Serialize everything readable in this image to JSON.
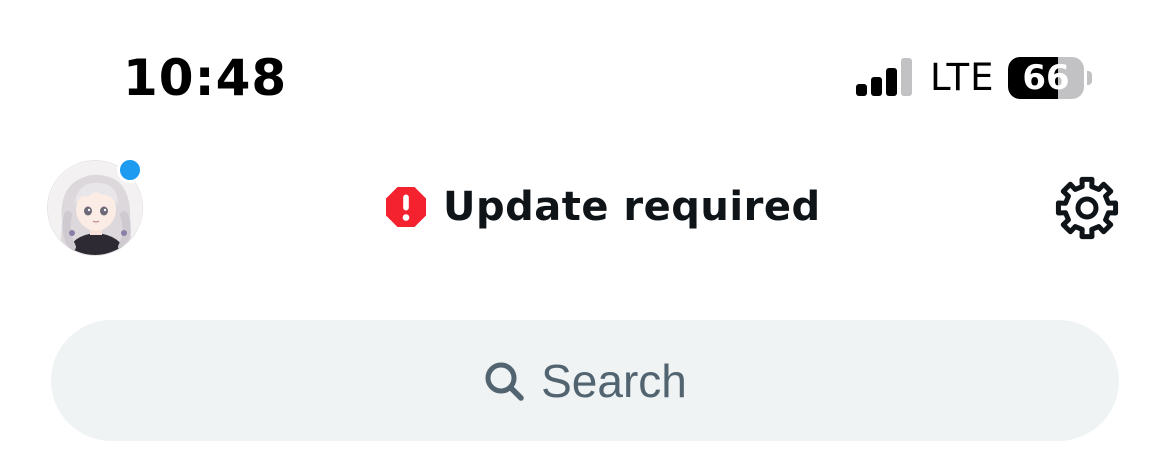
{
  "status_bar": {
    "time": "10:48",
    "network_type": "LTE",
    "signal_bars_filled": 3,
    "signal_bars_total": 4,
    "battery_level": "66",
    "battery_fraction": 0.66
  },
  "header": {
    "title": "Update required",
    "alert_icon": "exclamation-octagon-icon",
    "settings_icon": "gear-icon",
    "avatar_has_notification": true
  },
  "search": {
    "placeholder": "Search",
    "icon": "search-icon"
  },
  "colors": {
    "alert_red": "#f4212e",
    "notification_blue": "#1d9bf0",
    "search_bg": "#eff3f4",
    "search_text": "#536471",
    "title_text": "#0f1419"
  }
}
